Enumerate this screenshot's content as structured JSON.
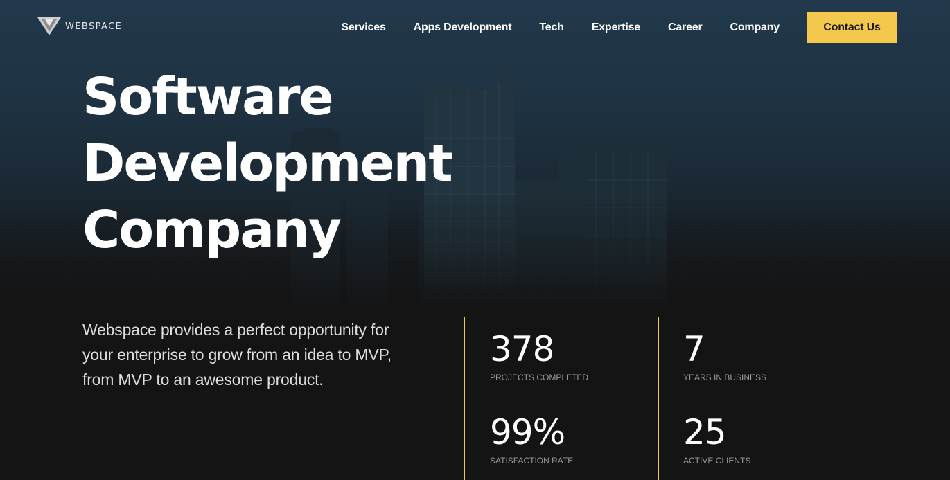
{
  "brand": {
    "name": "WEBSPACE",
    "logo_icon": "triangle-logo-icon",
    "accent_color": "#f4c84c"
  },
  "nav": {
    "items": [
      "Services",
      "Apps Development",
      "Tech",
      "Expertise",
      "Career",
      "Company"
    ],
    "cta_label": "Contact Us"
  },
  "hero": {
    "title_lines": [
      "Software",
      "Development",
      "Company"
    ],
    "description": "Webspace provides a perfect opportunity for your enterprise to grow from an idea to MVP, from MVP to an awesome product."
  },
  "stats": [
    {
      "value": "378",
      "label": "PROJECTS COMPLETED"
    },
    {
      "value": "7",
      "label": "YEARS IN BUSINESS"
    },
    {
      "value": "99%",
      "label": "SATISFACTION RATE"
    },
    {
      "value": "25",
      "label": "ACTIVE CLIENTS"
    }
  ]
}
